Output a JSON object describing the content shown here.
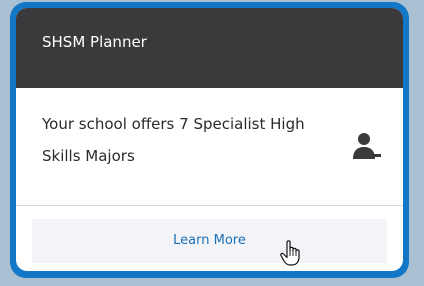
{
  "card": {
    "title": "SHSM Planner",
    "message": "Your school offers 7 Specialist High Skills Majors",
    "icon": "person-remove-icon",
    "button_label": "Learn More"
  },
  "cursor": {
    "icon": "hand-pointer-icon"
  },
  "colors": {
    "frame": "#1177c6",
    "header_bg": "#3a3a3c",
    "button_bg": "#f2f4f7",
    "button_text": "#1b6fb5",
    "background": "#a9c0d2"
  }
}
